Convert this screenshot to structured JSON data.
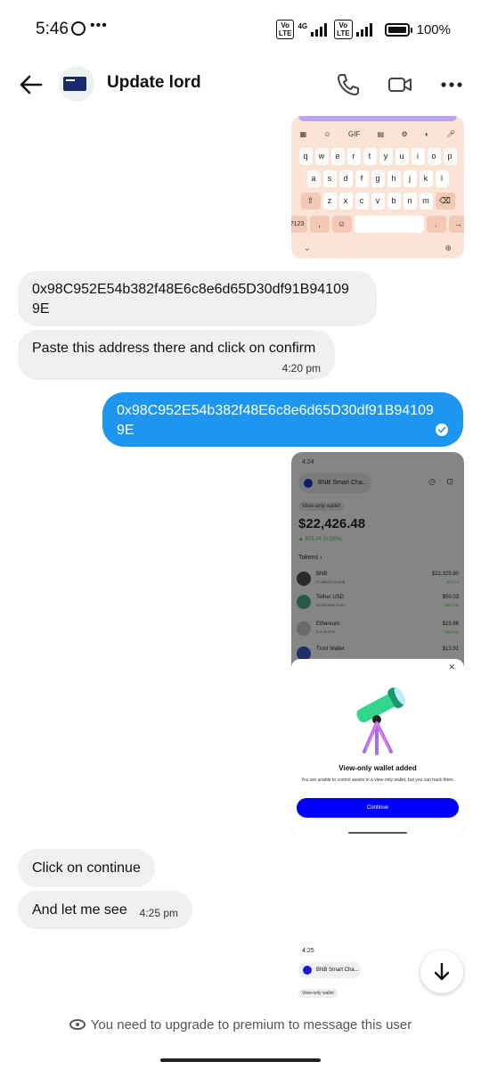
{
  "status_bar": {
    "time": "5:46",
    "dots": "•••",
    "network": "4G",
    "volte": "Vo LTE",
    "battery": "100%"
  },
  "header": {
    "contact_name": "Update lord"
  },
  "messages": [
    {
      "direction": "in",
      "text_line1": "0x98C952E54b382f48E6c8e6d65D30df91B94109",
      "text_line2": "9E"
    },
    {
      "direction": "in",
      "text": "Paste this address there and click on confirm",
      "time": "4:20 pm"
    },
    {
      "direction": "out",
      "text_line1": "0x98C952E54b382f48E6c8e6d65D30df91B94109",
      "text_line2": "9E"
    },
    {
      "direction": "in",
      "text": "Click on continue"
    },
    {
      "direction": "in",
      "text": "And let me see",
      "time": "4:25 pm"
    }
  ],
  "keyboard_image": {
    "row1": [
      "q",
      "w",
      "e",
      "r",
      "t",
      "y",
      "u",
      "i",
      "o",
      "p"
    ],
    "row2": [
      "a",
      "s",
      "d",
      "f",
      "g",
      "h",
      "j",
      "k",
      "l"
    ],
    "row3": [
      "z",
      "x",
      "c",
      "v",
      "b",
      "n",
      "m"
    ],
    "num_key": "?123",
    "comma": ",",
    "period": "."
  },
  "wallet_image": {
    "time": "4:24",
    "network": "BNB Smart Cha...",
    "tag": "View-only wallet",
    "balance": "$22,426.48",
    "change": "▲ $73.24 (0.33%)",
    "tokens_label": "Tokens",
    "tokens": [
      {
        "name": "BNB",
        "amount": "37.85521174 BNB",
        "value": "$22,325.90",
        "delta": "+$73.14"
      },
      {
        "name": "Tether USD",
        "amount": "50.0354509 USDT",
        "value": "$50.03",
        "delta": "+$0.0135"
      },
      {
        "name": "Ethereum",
        "amount": "0.0109 ETH",
        "value": "$19.86",
        "delta": "+$0.0298"
      },
      {
        "name": "Trust Wallet",
        "amount": "",
        "value": "$13.91",
        "delta": ""
      }
    ],
    "sheet_title": "View-only wallet added",
    "sheet_desc": "You are unable to control assets in a view-only wallet, but you can track them.",
    "sheet_button": "Continue",
    "close_glyph": "✕"
  },
  "wallet_image2": {
    "time": "4:25",
    "network": "BNB Smart Cha...",
    "tag": "View-only wallet"
  },
  "footer": {
    "premium_notice": "You need to upgrade to premium to message this user"
  },
  "colors": {
    "outgoing_bubble": "#1e96f0",
    "incoming_bubble": "#eef0f2",
    "continue_button": "#0000ff"
  }
}
